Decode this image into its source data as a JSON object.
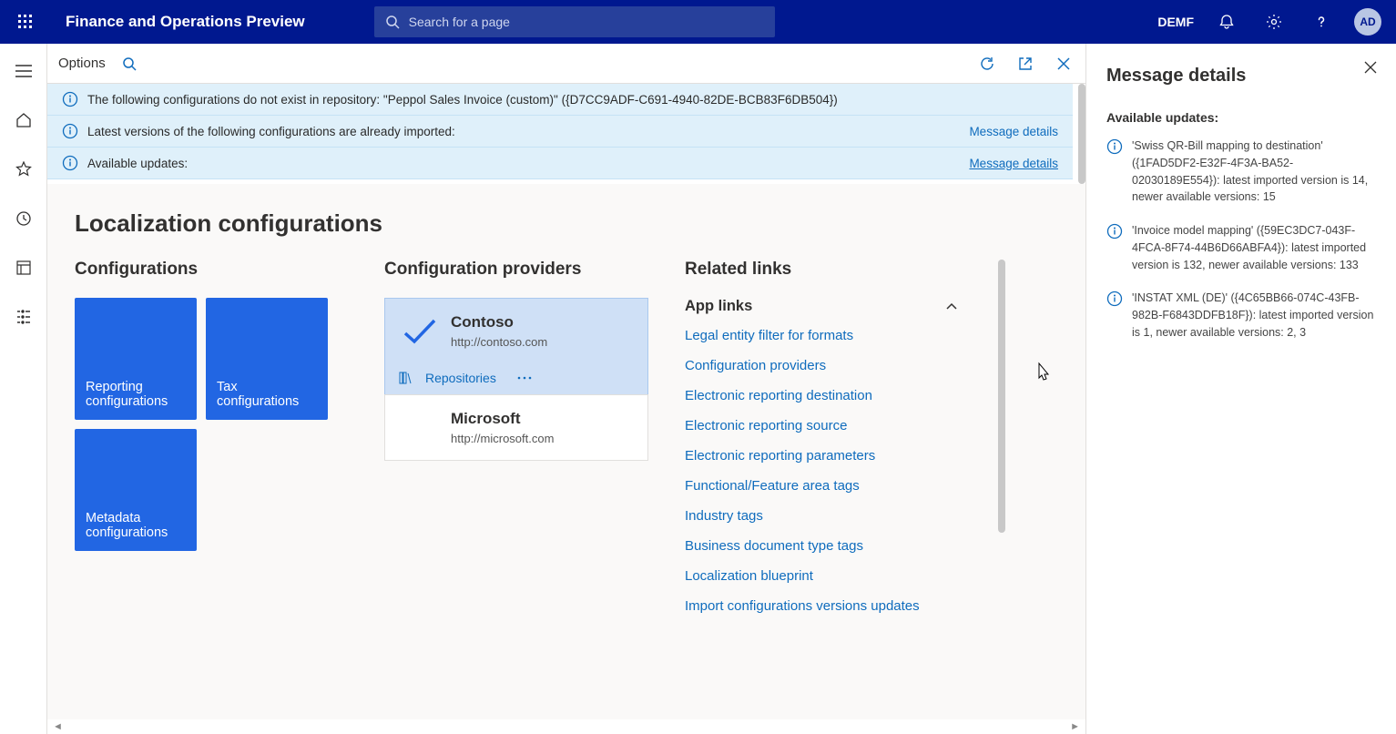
{
  "header": {
    "app_title": "Finance and Operations Preview",
    "search_placeholder": "Search for a page",
    "company": "DEMF",
    "avatar": "AD"
  },
  "toolbar": {
    "options": "Options"
  },
  "infobars": [
    {
      "text": "The following configurations do not exist in repository:   \"Peppol Sales Invoice (custom)\" ({D7CC9ADF-C691-4940-82DE-BCB83F6DB504})",
      "link": ""
    },
    {
      "text": "Latest versions of the following configurations are already imported:",
      "link": "Message details"
    },
    {
      "text": "Available updates:",
      "link": "Message details"
    }
  ],
  "page": {
    "title": "Localization configurations",
    "configs_heading": "Configurations",
    "providers_heading": "Configuration providers",
    "related_heading": "Related links",
    "applinks_heading": "App links",
    "tiles": [
      "Reporting configurations",
      "Tax configurations",
      "Metadata configurations"
    ],
    "providers": [
      {
        "name": "Contoso",
        "url": "http://contoso.com",
        "active": true
      },
      {
        "name": "Microsoft",
        "url": "http://microsoft.com",
        "active": false
      }
    ],
    "repositories_label": "Repositories",
    "links": [
      "Legal entity filter for formats",
      "Configuration providers",
      "Electronic reporting destination",
      "Electronic reporting source",
      "Electronic reporting parameters",
      "Functional/Feature area tags",
      "Industry tags",
      "Business document type tags",
      "Localization blueprint",
      "Import configurations versions updates"
    ]
  },
  "panel": {
    "title": "Message details",
    "subtitle": "Available updates:",
    "messages": [
      "'Swiss QR-Bill mapping to destination' ({1FAD5DF2-E32F-4F3A-BA52-02030189E554}): latest imported version is 14, newer available versions: 15",
      "'Invoice model mapping' ({59EC3DC7-043F-4FCA-8F74-44B6D66ABFA4}): latest imported version is 132, newer available versions: 133",
      "'INSTAT XML (DE)' ({4C65BB66-074C-43FB-982B-F6843DDFB18F}): latest imported version is 1, newer available versions: 2, 3"
    ]
  }
}
